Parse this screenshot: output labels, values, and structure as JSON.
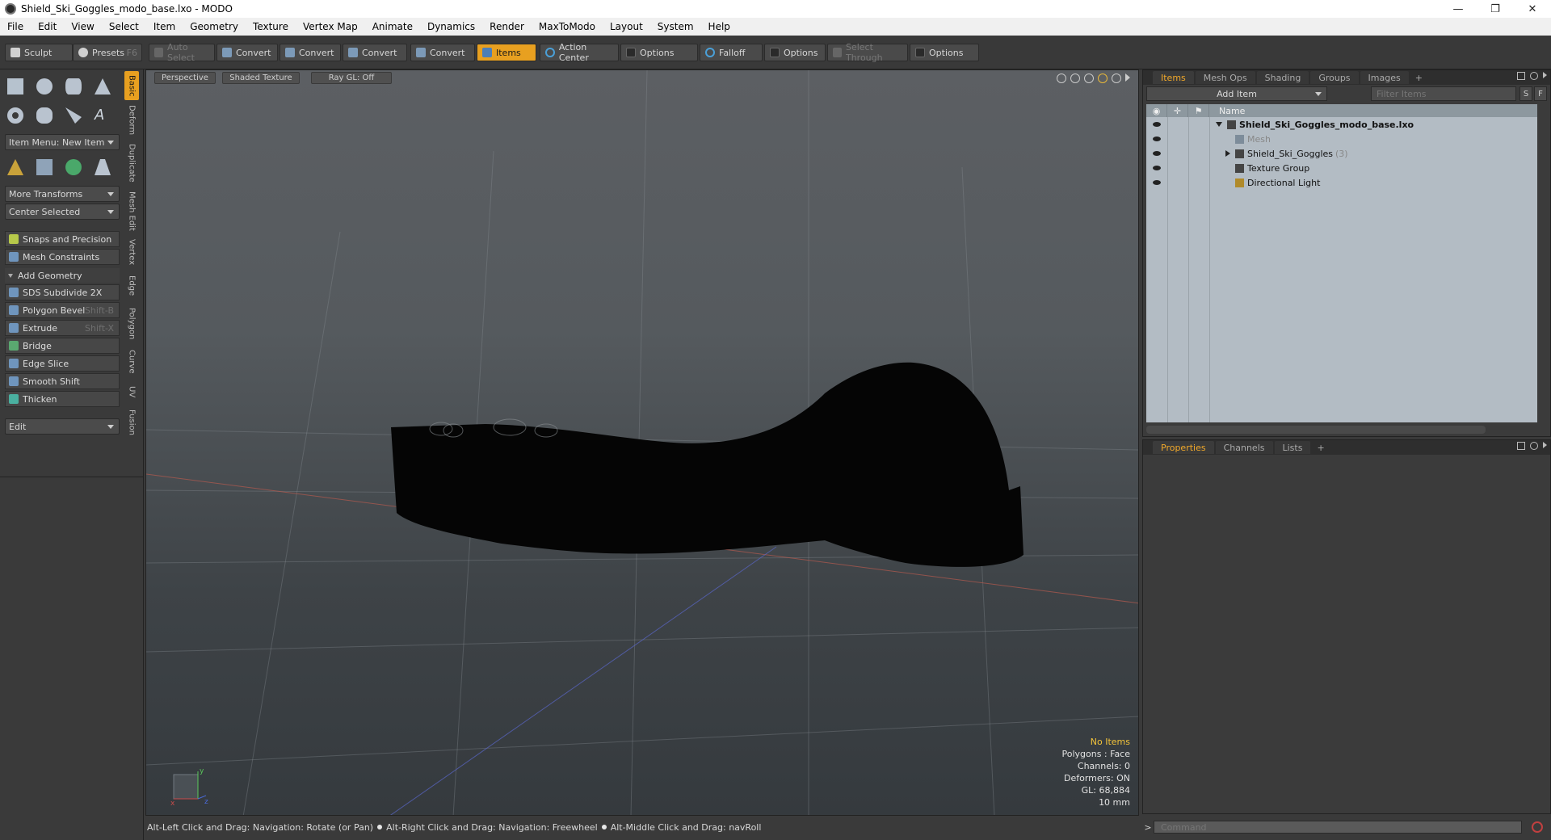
{
  "window": {
    "title": "Shield_Ski_Goggles_modo_base.lxo - MODO",
    "buttons": [
      "—",
      "❐",
      "✕"
    ]
  },
  "menu": [
    "File",
    "Edit",
    "View",
    "Select",
    "Item",
    "Geometry",
    "Texture",
    "Vertex Map",
    "Animate",
    "Dynamics",
    "Render",
    "MaxToModo",
    "Layout",
    "System",
    "Help"
  ],
  "toolbar": {
    "sculpt": "Sculpt",
    "presets": "Presets",
    "presets_key": "F6",
    "auto_select": "Auto Select",
    "convert1": "Convert",
    "convert2": "Convert",
    "convert3": "Convert",
    "convert4": "Convert",
    "items": "Items",
    "action_center": "Action Center",
    "options1": "Options",
    "falloff": "Falloff",
    "options2": "Options",
    "select_through": "Select Through",
    "options3": "Options"
  },
  "left": {
    "item_menu": "Item Menu: New Item",
    "more_transforms": "More Transforms",
    "center_selected": "Center Selected",
    "snaps": "Snaps and Precision",
    "mesh_constraints": "Mesh Constraints",
    "add_geometry": "Add Geometry",
    "tools": [
      {
        "label": "SDS Subdivide 2X",
        "shortcut": ""
      },
      {
        "label": "Polygon Bevel",
        "shortcut": "Shift-B"
      },
      {
        "label": "Extrude",
        "shortcut": "Shift-X"
      },
      {
        "label": "Bridge",
        "shortcut": ""
      },
      {
        "label": "Edge Slice",
        "shortcut": ""
      },
      {
        "label": "Smooth Shift",
        "shortcut": ""
      },
      {
        "label": "Thicken",
        "shortcut": ""
      }
    ],
    "edit": "Edit"
  },
  "vtabs": [
    "Basic",
    "Deform",
    "Duplicate",
    "Mesh Edit",
    "Vertex",
    "Edge",
    "Polygon",
    "Curve",
    "UV",
    "Fusion"
  ],
  "viewport": {
    "view_mode": "Perspective",
    "shading": "Shaded Texture",
    "raygl": "Ray GL: Off",
    "info": {
      "selection": "No Items",
      "polygons": "Polygons : Face",
      "channels": "Channels: 0",
      "deformers": "Deformers: ON",
      "gl": "GL: 68,884",
      "scale": "10 mm"
    },
    "axis": {
      "x": "x",
      "y": "y",
      "z": "z"
    }
  },
  "status": {
    "hint1": "Alt-Left Click and Drag: Navigation: Rotate (or Pan)",
    "hint2": "Alt-Right Click and Drag: Navigation: Freewheel",
    "hint3": "Alt-Middle Click and Drag: navRoll"
  },
  "items_panel": {
    "tabs": [
      "Items",
      "Mesh Ops",
      "Shading",
      "Groups",
      "Images",
      "+"
    ],
    "add_item": "Add Item",
    "filter_placeholder": "Filter Items",
    "s_btn": "S",
    "f_btn": "F",
    "name_col": "Name",
    "tree": [
      {
        "name": "Shield_Ski_Goggles_modo_base.lxo",
        "level": 0,
        "bold": true,
        "expander": "down"
      },
      {
        "name": "Mesh",
        "level": 1,
        "dim": true,
        "expander": ""
      },
      {
        "name": "Shield_Ski_Goggles",
        "count": "(3)",
        "level": 1,
        "expander": "right"
      },
      {
        "name": "Texture Group",
        "level": 1,
        "expander": ""
      },
      {
        "name": "Directional Light",
        "level": 1,
        "expander": ""
      }
    ]
  },
  "props_panel": {
    "tabs": [
      "Properties",
      "Channels",
      "Lists",
      "+"
    ]
  },
  "command": {
    "prompt": ">",
    "placeholder": "Command"
  },
  "colors": {
    "accent": "#e8a020",
    "tree_bg": "#b3bcc4"
  }
}
